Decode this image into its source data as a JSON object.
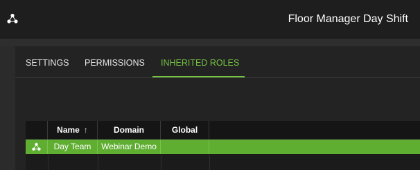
{
  "window": {
    "title": "Floor Manager Day Shift",
    "app_icon": "triad-circles-icon"
  },
  "tabs": [
    {
      "label": "SETTINGS",
      "active": false
    },
    {
      "label": "PERMISSIONS",
      "active": false
    },
    {
      "label": "INHERITED ROLES",
      "active": true
    }
  ],
  "table": {
    "columns": [
      {
        "label": "Name",
        "sort": "ascending"
      },
      {
        "label": "Domain"
      },
      {
        "label": "Global"
      }
    ],
    "sort_indicator": "↑",
    "rows": [
      {
        "icon": "triad-circles-icon",
        "name": "Day Team",
        "domain": "Webinar Demo",
        "global": "",
        "selected": true
      }
    ]
  },
  "colors": {
    "accent": "#76c442",
    "selected_row": "#5fae32",
    "topbar": "#1e1e1e",
    "panel": "#232323"
  }
}
